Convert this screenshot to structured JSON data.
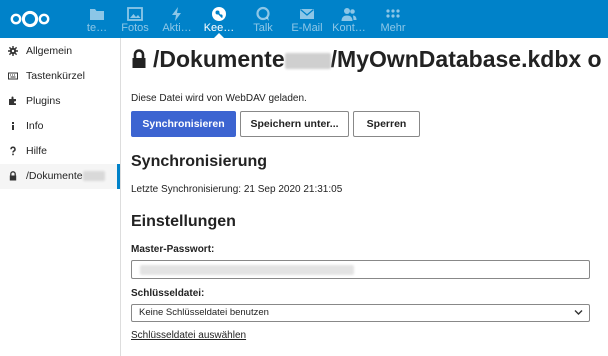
{
  "colors": {
    "brand": "#0082c9",
    "primary_button": "#3c64d1",
    "active_nav_bar": "#0082c9"
  },
  "topbar": {
    "logo_icon": "nextcloud-logo-icon",
    "apps": [
      {
        "label": "te…",
        "icon": "folder-icon",
        "active": false
      },
      {
        "label": "Fotos",
        "icon": "image-icon",
        "active": false
      },
      {
        "label": "Akti…",
        "icon": "lightning-icon",
        "active": false
      },
      {
        "label": "Kee…",
        "icon": "key-icon",
        "active": true
      },
      {
        "label": "Talk",
        "icon": "chat-icon",
        "active": false
      },
      {
        "label": "E-Mail",
        "icon": "mail-icon",
        "active": false
      },
      {
        "label": "Kont…",
        "icon": "contacts-icon",
        "active": false
      },
      {
        "label": "Mehr",
        "icon": "more-dots-icon",
        "active": false
      }
    ]
  },
  "sidebar": {
    "items": [
      {
        "label": "Allgemein",
        "icon": "gear-icon"
      },
      {
        "label": "Tastenkürzel",
        "icon": "keyboard-icon"
      },
      {
        "label": "Plugins",
        "icon": "puzzle-icon"
      },
      {
        "label": "Info",
        "icon": "info-icon"
      },
      {
        "label": "Hilfe",
        "icon": "question-icon"
      },
      {
        "label": "/Dokumente",
        "icon": "lock-icon",
        "active": true
      }
    ]
  },
  "main": {
    "title_prefix": "/Dokumente",
    "title_suffix": "/MyOwnDatabase.kdbx o",
    "info_text": "Diese Datei wird von WebDAV geladen.",
    "buttons": {
      "sync": "Synchronisieren",
      "save_as": "Speichern unter...",
      "lock": "Sperren"
    },
    "sync_heading": "Synchronisierung",
    "last_sync": "Letzte Synchronisierung: 21 Sep 2020 21:31:05",
    "settings_heading": "Einstellungen",
    "master_password_label": "Master-Passwort:",
    "keyfile_label": "Schlüsseldatei:",
    "keyfile_selected": "Keine Schlüsseldatei benutzen",
    "keyfile_link": "Schlüsseldatei auswählen"
  }
}
